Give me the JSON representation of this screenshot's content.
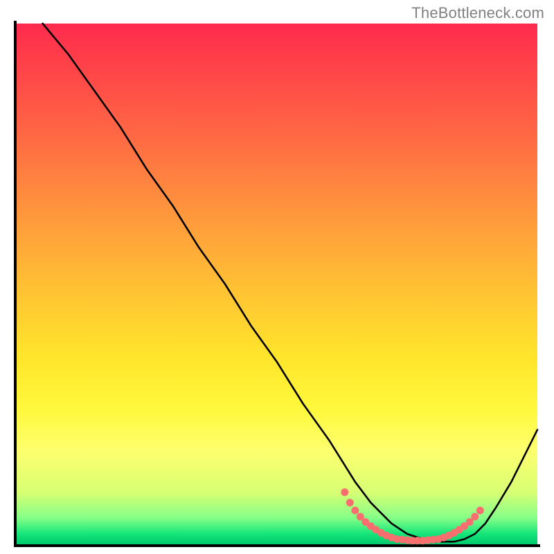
{
  "watermark": "TheBottleneck.com",
  "chart_data": {
    "type": "line",
    "title": "",
    "xlabel": "",
    "ylabel": "",
    "xlim": [
      0,
      100
    ],
    "ylim": [
      0,
      100
    ],
    "grid": false,
    "legend": false,
    "background": "rainbow-vertical",
    "series": [
      {
        "name": "curve",
        "color": "#000000",
        "x": [
          5,
          10,
          15,
          20,
          25,
          30,
          35,
          40,
          45,
          50,
          55,
          60,
          65,
          68,
          70,
          72,
          75,
          78,
          80,
          82,
          84,
          86,
          88,
          90,
          92,
          95,
          100
        ],
        "y": [
          100,
          94,
          87,
          80,
          72,
          65,
          57,
          50,
          42,
          35,
          27,
          20,
          12,
          8,
          6,
          4,
          2,
          1,
          0.5,
          0.5,
          0.5,
          1,
          2,
          4,
          7,
          12,
          22
        ]
      }
    ],
    "markers": [
      {
        "name": "highlight-dots",
        "color": "#f96e6e",
        "x": [
          63,
          64,
          65,
          66,
          67,
          68,
          69,
          70,
          71,
          72,
          73,
          74,
          75,
          76,
          77,
          78,
          79,
          80,
          81,
          82,
          83,
          84,
          85,
          86,
          87,
          88,
          89
        ],
        "y": [
          10,
          8,
          6.5,
          5.3,
          4.3,
          3.5,
          2.8,
          2.2,
          1.7,
          1.3,
          1.0,
          0.9,
          0.8,
          0.7,
          0.7,
          0.7,
          0.8,
          0.9,
          1.0,
          1.3,
          1.7,
          2.2,
          2.8,
          3.5,
          4.3,
          5.3,
          6.5
        ]
      }
    ]
  }
}
